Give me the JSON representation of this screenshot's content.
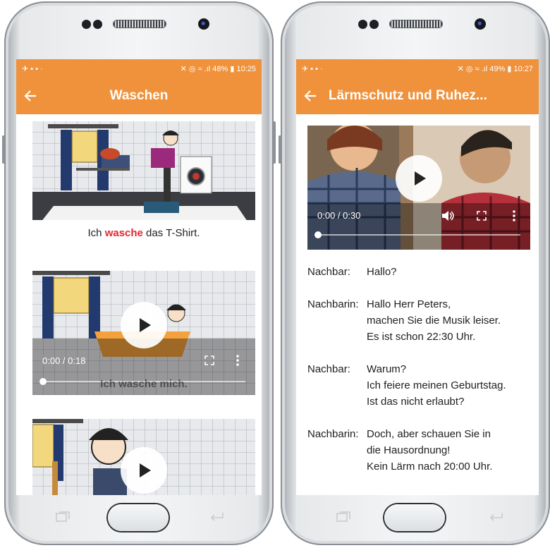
{
  "left_phone": {
    "status": {
      "left_icons": "✈ ▪ ▪ ·",
      "right": "48% ▮ 10:25",
      "signal_icons": "✕ ◎ ≈ .ıl"
    },
    "appbar": {
      "title": "Waschen"
    },
    "video1": {
      "caption_pre": "Ich ",
      "caption_hl": "wasche",
      "caption_post": " das T-Shirt."
    },
    "video2": {
      "time": "0:00 / 0:18",
      "caption": "Ich wasche mich."
    }
  },
  "right_phone": {
    "status": {
      "left_icons": "✈ ▪ ▪ ·",
      "right": "49% ▮ 10:27",
      "signal_icons": "✕ ◎ ≈ .ıl"
    },
    "appbar": {
      "title": "Lärmschutz und Ruhez..."
    },
    "video": {
      "time": "0:00 / 0:30"
    },
    "dialog": [
      {
        "speaker": "Nachbar:",
        "lines": [
          "Hallo?"
        ]
      },
      {
        "speaker": "Nachbarin:",
        "lines": [
          "Hallo Herr Peters,",
          "machen Sie die Musik leiser.",
          "Es ist schon 22:30 Uhr."
        ]
      },
      {
        "speaker": "Nachbar:",
        "lines": [
          "Warum?",
          "Ich feiere meinen Geburtstag.",
          "Ist das nicht erlaubt?"
        ]
      },
      {
        "speaker": "Nachbarin:",
        "lines": [
          "Doch, aber schauen Sie in",
          "die Hausordnung!",
          "Kein Lärm nach 20:00 Uhr."
        ]
      }
    ]
  },
  "colors": {
    "accent": "#f0923b",
    "highlight": "#e3272f"
  },
  "icons": [
    "back-arrow-icon",
    "play-icon",
    "volume-icon",
    "fullscreen-icon",
    "more-vert-icon",
    "recent-apps-icon",
    "back-nav-icon"
  ]
}
